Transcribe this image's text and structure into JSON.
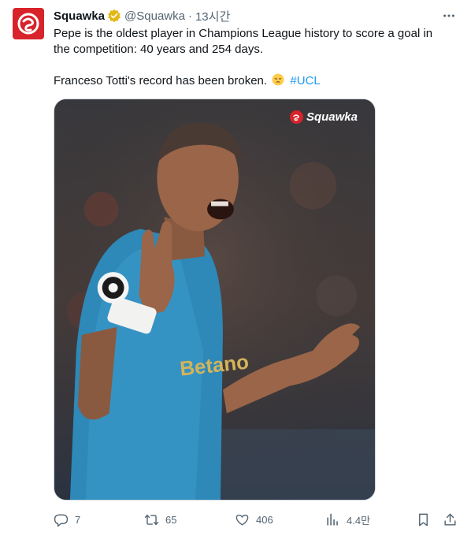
{
  "author": {
    "name": "Squawka",
    "handle": "@Squawka",
    "time": "13시간"
  },
  "tweet": {
    "line1": "Pepe is the oldest player in Champions League history to score a goal in the competition: 40 years and 254 days.",
    "line2_text": "Franceso Totti's record has been broken.",
    "hashtag": "#UCL"
  },
  "media": {
    "watermark": "Squawka"
  },
  "actions": {
    "replies": "7",
    "retweets": "65",
    "likes": "406",
    "views": "4.4만"
  },
  "colors": {
    "brand": "#d8232a",
    "link": "#1d9bf0",
    "muted": "#536471",
    "verified": "#e2b719"
  },
  "icons": [
    "more-icon",
    "verified-badge-icon",
    "reply-icon",
    "retweet-icon",
    "like-icon",
    "views-icon",
    "bookmark-icon",
    "share-icon"
  ]
}
